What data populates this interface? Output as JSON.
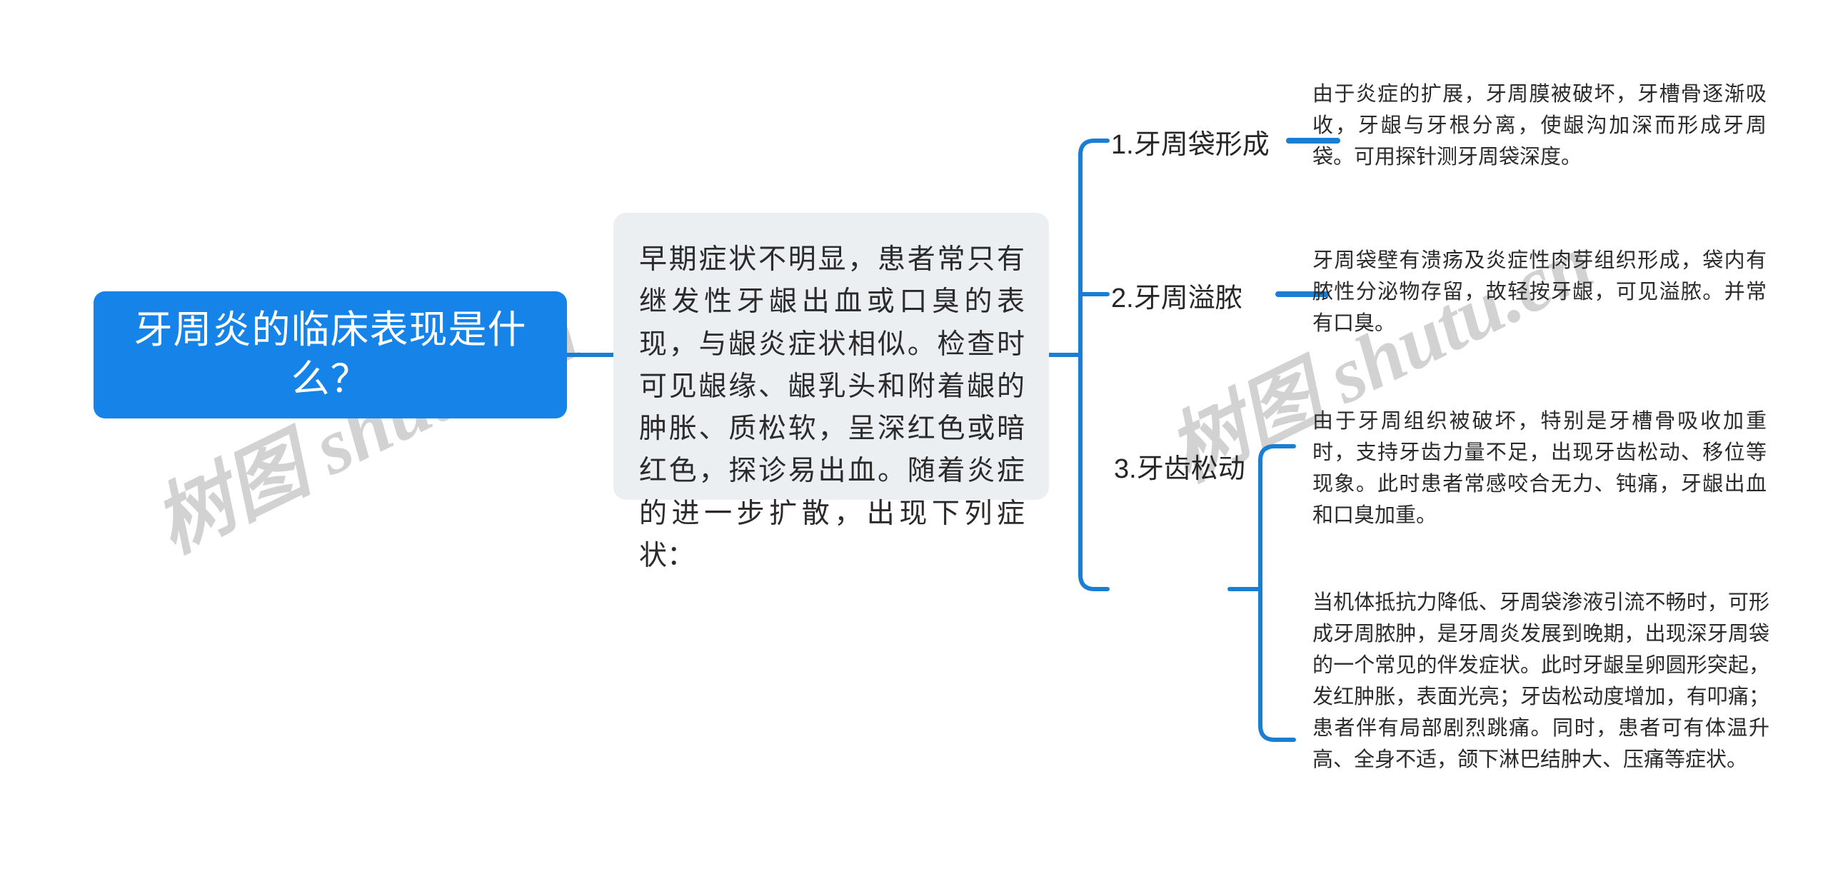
{
  "palette": {
    "accent_blue": "#1683E8",
    "link_blue": "#1a7fd4",
    "panel_gray": "#ECEFF1",
    "text_dark": "#2b2b2b",
    "watermark_gray": "#d2d2d2",
    "canvas_white": "#ffffff"
  },
  "watermark": {
    "text": "树图 shutu.cn"
  },
  "root": {
    "title": "牙周炎的临床表现是什么？"
  },
  "center": {
    "summary": "早期症状不明显，患者常只有继发性牙龈出血或口臭的表现，与龈炎症状相似。检查时可见龈缘、龈乳头和附着龈的肿胀、质松软，呈深红色或暗红色，探诊易出血。随着炎症的进一步扩散，出现下列症状："
  },
  "branches": [
    {
      "label": "1.牙周袋形成",
      "details": [
        "由于炎症的扩展，牙周膜被破坏，牙槽骨逐渐吸收，牙龈与牙根分离，使龈沟加深而形成牙周袋。可用探针测牙周袋深度。"
      ]
    },
    {
      "label": "2.牙周溢脓",
      "details": [
        "牙周袋壁有溃疡及炎症性肉芽组织形成，袋内有脓性分泌物存留，故轻按牙龈，可见溢脓。并常有口臭。"
      ]
    },
    {
      "label": "3.牙齿松动",
      "details": [
        "由于牙周组织被破坏，特别是牙槽骨吸收加重时，支持牙齿力量不足，出现牙齿松动、移位等现象。此时患者常感咬合无力、钝痛，牙龈出血和口臭加重。",
        "当机体抵抗力降低、牙周袋渗液引流不畅时，可形成牙周脓肿，是牙周炎发展到晚期，出现深牙周袋的一个常见的伴发症状。此时牙龈呈卵圆形突起，发红肿胀，表面光亮；牙齿松动度增加，有叩痛；患者伴有局部剧烈跳痛。同时，患者可有体温升高、全身不适，颌下淋巴结肿大、压痛等症状。"
      ]
    }
  ]
}
